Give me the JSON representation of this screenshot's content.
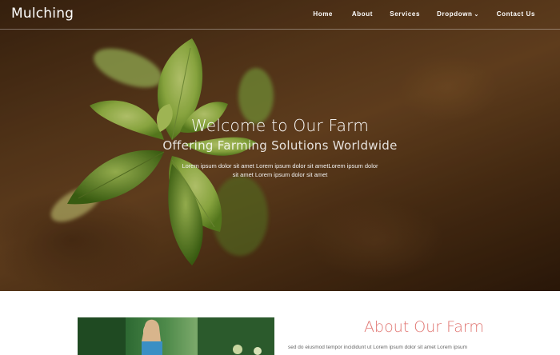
{
  "header": {
    "logo": "Mulching",
    "nav": [
      {
        "label": "Home"
      },
      {
        "label": "About"
      },
      {
        "label": "Services"
      },
      {
        "label": "Dropdown",
        "icon": "chevron-down-icon"
      },
      {
        "label": "Contact Us"
      }
    ]
  },
  "hero": {
    "title": "Welcome to Our Farm",
    "subtitle": "Offering Farming Solutions Worldwide",
    "description": "Lorem ipsum dolor sit amet Lorem ipsum dolor sit ametLorem ipsum dolor sit amet Lorem ipsum dolor sit amet"
  },
  "about": {
    "title": "About Our Farm",
    "text": "sed do eiusmod tempor incididunt ut Lorem ipsum dolor sit amet Lorem ipsum"
  },
  "colors": {
    "accent": "#e0736f",
    "hero_overlay_text": "#ffffff"
  }
}
